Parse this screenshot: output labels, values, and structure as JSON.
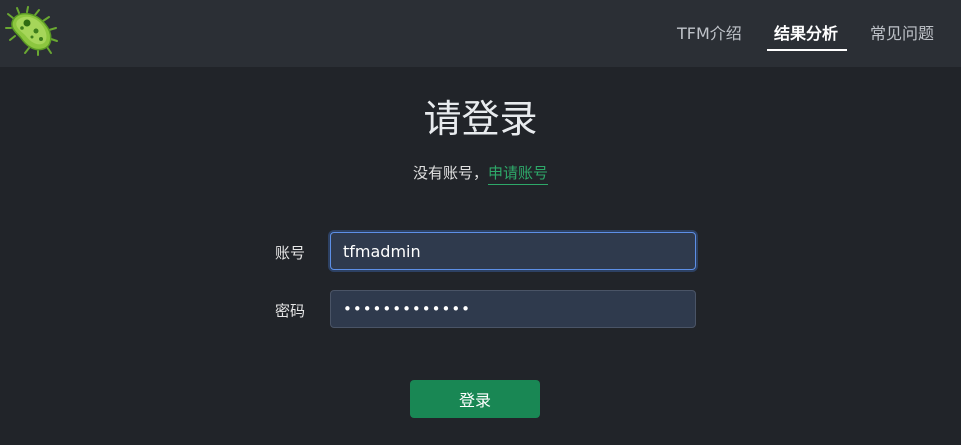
{
  "nav": {
    "items": [
      {
        "label": "TFM介绍",
        "active": false
      },
      {
        "label": "结果分析",
        "active": true
      },
      {
        "label": "常见问题",
        "active": false
      }
    ]
  },
  "logo": {
    "icon": "bacteria-icon"
  },
  "login": {
    "title": "请登录",
    "no_account_text": "没有账号，",
    "register_link": "申请账号",
    "account_label": "账号",
    "account_value": "tfmadmin",
    "password_label": "密码",
    "password_value": "•••••••••••••",
    "submit_label": "登录"
  },
  "colors": {
    "background": "#212429",
    "navbar": "#2b2f35",
    "accent_green": "#198754",
    "link_green": "#2ea869",
    "input_bg": "#2f3a4d",
    "focus_border": "#5d8fe6"
  }
}
